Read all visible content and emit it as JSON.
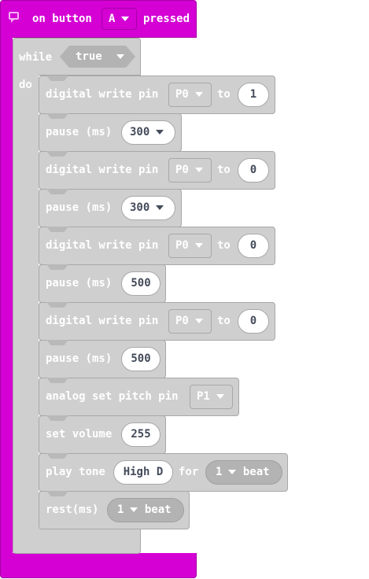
{
  "event": {
    "prefix": "on button",
    "button": "A",
    "suffix": "pressed"
  },
  "loop": {
    "keyword": "while",
    "condition": "true",
    "do_label": "do"
  },
  "blocks": [
    {
      "label": "digital write pin",
      "pin": "P0",
      "to": "to",
      "value": "1"
    },
    {
      "label": "pause (ms)",
      "value": "300"
    },
    {
      "label": "digital write pin",
      "pin": "P0",
      "to": "to",
      "value": "0"
    },
    {
      "label": "pause (ms)",
      "value": "300"
    },
    {
      "label": "digital write pin",
      "pin": "P0",
      "to": "to",
      "value": "0"
    },
    {
      "label": "pause (ms)",
      "value": "500"
    },
    {
      "label": "digital write pin",
      "pin": "P0",
      "to": "to",
      "value": "0"
    },
    {
      "label": "pause (ms)",
      "value": "500"
    },
    {
      "label": "analog set pitch pin",
      "pin": "P1"
    },
    {
      "label": "set volume",
      "value": "255"
    },
    {
      "label": "play tone",
      "note": "High D",
      "for": "for",
      "beat_count": "1",
      "beat_unit": "beat"
    },
    {
      "label": "rest(ms)",
      "beat_count": "1",
      "beat_unit": "beat"
    }
  ],
  "colors": {
    "event": "#d400d4",
    "logic": "#cfcfcf",
    "dropdown": "#b3b3b3"
  }
}
